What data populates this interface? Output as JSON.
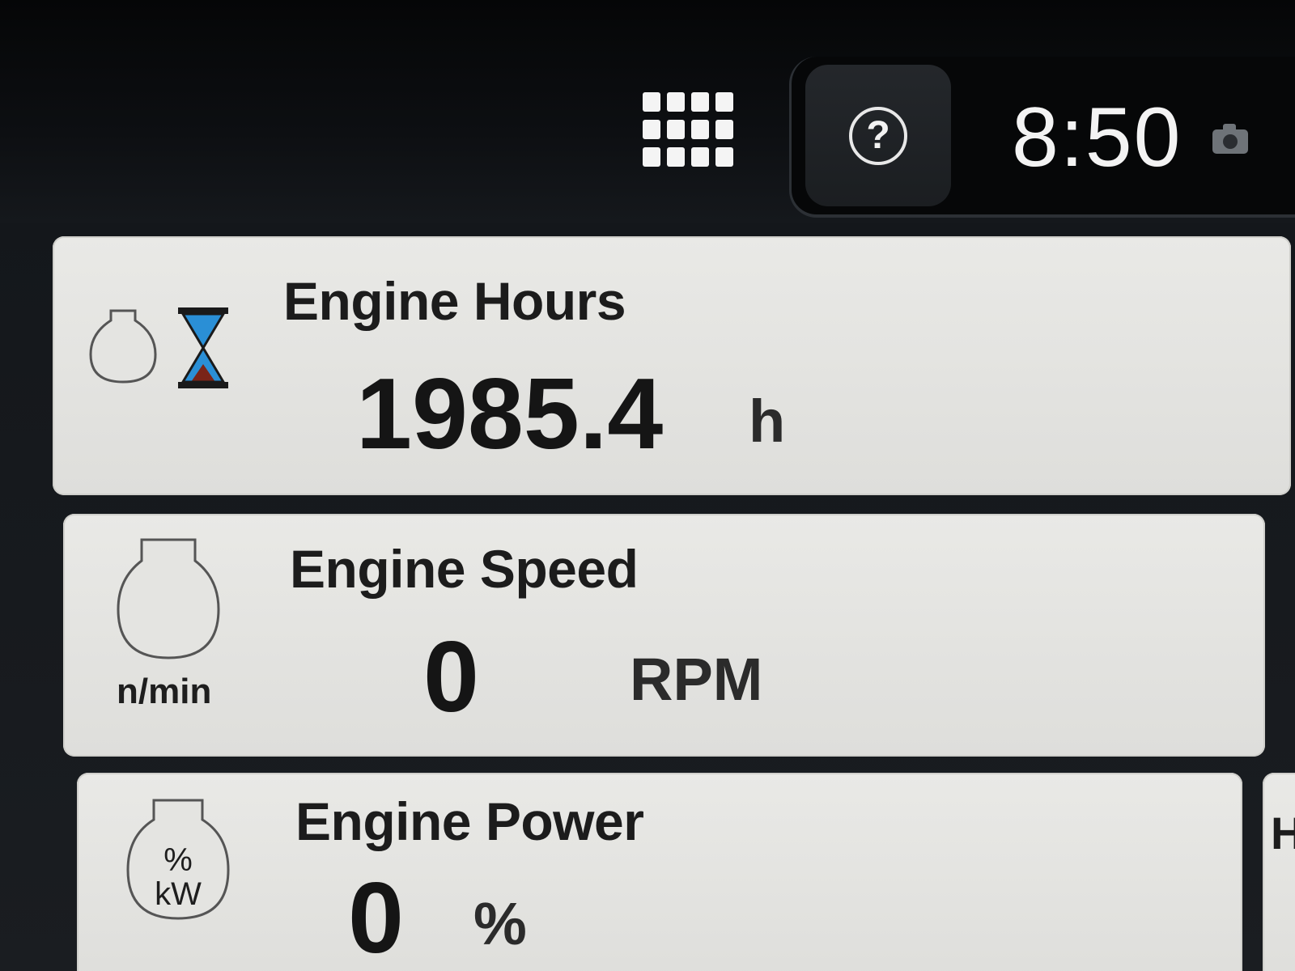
{
  "topbar": {
    "apps_icon": "apps-grid-icon",
    "help_icon": "question-mark-icon",
    "help_glyph": "?",
    "clock": "8:50",
    "camera_icon": "camera-icon"
  },
  "tiles": [
    {
      "title": "Engine Hours",
      "value": "1985.4",
      "unit": "h",
      "icon": "engine-hourglass-icon"
    },
    {
      "title": "Engine Speed",
      "value": "0",
      "unit": "RPM",
      "icon": "engine-speed-icon",
      "icon_label": "n/min"
    },
    {
      "title": "Engine Power",
      "value": "0",
      "unit": "%",
      "icon": "engine-power-icon",
      "icon_label_top": "%",
      "icon_label_bottom": "kW"
    }
  ],
  "right_tile": {
    "label": "H"
  },
  "colors": {
    "tile_bg": "#e6e6e3",
    "hourglass_blue": "#2a8fd6",
    "hourglass_sand": "#7a2418",
    "background": "#0b0c0e"
  }
}
